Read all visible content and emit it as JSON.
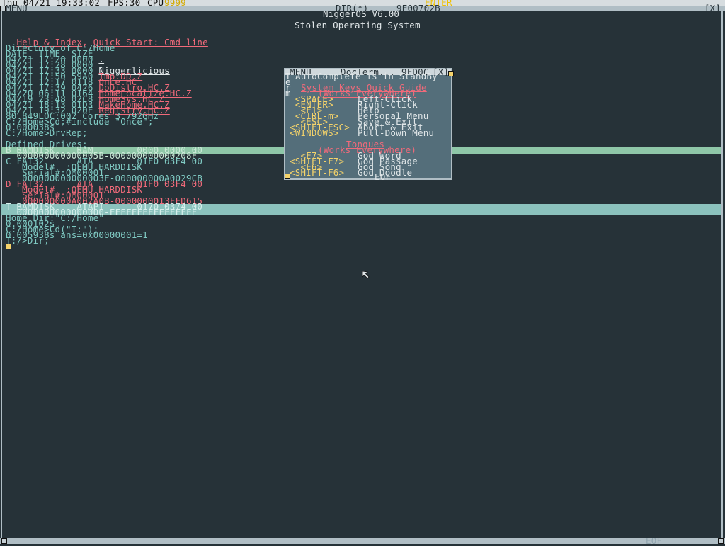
{
  "topbar": {
    "date_time": "Thu 04/21 19:33:02",
    "fps": "FPS:30",
    "cpu_label": "CPU",
    "cpu_value": "9999",
    "enter": "ENTER"
  },
  "window": {
    "menu_label": "MENU",
    "os_title": "NiggerOS V6.00",
    "subtitle": "Stolen Operating System",
    "close": "[X]",
    "title_mid": "DIR(*)...",
    "title_addr": "9E00702B"
  },
  "help_line": {
    "help": "Help & Index",
    "sep": ", ",
    "quick": "Quick Start: Cmd line"
  },
  "dir_header": "Directory of C:/Home",
  "dir_columns": "DATE_ TIME_ SIZE",
  "dir_rows": [
    {
      "meta": "04/21 17:28 0000",
      "name": "."
    },
    {
      "meta": "04/21 17:28 0000",
      "name": ".."
    },
    {
      "meta": "04/21 17:33 0000",
      "name": "Niggerlicious"
    },
    {
      "meta": "04/21 17:50 59A0",
      "name": "Tmp.DD.Z"
    },
    {
      "meta": "04/21 12:17 0118",
      "name": "Once.HC"
    },
    {
      "meta": "04/21 17:39 0426",
      "name": "DoDistro.HC.Z"
    },
    {
      "meta": "04/20 06:11 0164",
      "name": "HomeLocalize.HC.Z"
    },
    {
      "meta": "04/19 23:48 02C8",
      "name": "HomeSys.HC.Z"
    },
    {
      "meta": "04/21 18:13 01D3",
      "name": "MakeHome.HC.Z"
    },
    {
      "meta": "04/21 19:32 020E",
      "name": "Registry.HC.Z"
    }
  ],
  "console_a": [
    "80.849LOC:002 Cores 3.792GHz",
    "C:/Home>Cd;#include \"Once\";",
    "0.000038s",
    "C:/Home>DrvRep;"
  ],
  "drives_header": "Defined Drives:",
  "drives": {
    "b_line1": "B RAMDISK    RAM        0000 0000 00",
    "b_line2": "  000000000000005B-000000000000208F",
    "c_line1": "C FAT32      ATA        01F0 03F4 00",
    "c_line2": "   Model#  :QEMU HARDDISK",
    "c_line3": "   Serial#:QM00001",
    "c_line4": "   000000000000003F-000000000A0029CB",
    "d_line1": "D FAT32      ATA        01F0 03F4 00",
    "d_line2": "   Model#  :QEMU HARDDISK",
    "d_line3": "   Serial#:QM00001",
    "d_line4": "   000000000A002A0B-0000000013FFD615",
    "t_line1": "T RAMDISK    ATAPI      0170 0374 00",
    "t_line2": "  0000000000000000-FFFFFFFFFFFFFFFF"
  },
  "console_b": [
    "Home Dir:\"C:/Home\"",
    "0.000102s",
    "C:/Home>Cd(\"T:\");",
    "0.005938s ans=0x00000001=1",
    "T:/>Dir;"
  ],
  "popup": {
    "menu": "MENU",
    "title": "DocTerm...",
    "addr": "9FD0C",
    "close": "[X]",
    "standby": "AutoComplete is in StandBy",
    "left_chars": [
      "T",
      "e",
      "r",
      "m"
    ],
    "keys_title": "System Keys Quick Guide",
    "works": "(Works Everywhere)",
    "keys": [
      {
        "key": " <SPACE> ",
        "desc": "Left-Click"
      },
      {
        "key": " <ENTER> ",
        "desc": "Right-Click"
      },
      {
        "key": "  <F1>   ",
        "desc": "Help"
      },
      {
        "key": " <CTRL-m>",
        "desc": "Personal Menu"
      },
      {
        "key": "  <ESC>  ",
        "desc": "Save & Exit"
      },
      {
        "key": "<SHIFT-ESC>",
        "desc": "Abort & Exit"
      },
      {
        "key": "<WINDOWS>",
        "desc": "Pull-Down Menu"
      }
    ],
    "tongues_title": "Tongues",
    "tongues_works": "(Works Everywhere)",
    "tongues": [
      {
        "key": "  <F7>   ",
        "desc": "God Word"
      },
      {
        "key": "<SHIFT-F7>",
        "desc": "God Passage"
      },
      {
        "key": "  <F6>   ",
        "desc": "God Song"
      },
      {
        "key": "<SHIFT-F6>",
        "desc": "God Doodle"
      }
    ],
    "eof": "EOF"
  },
  "bottom_eof": "EOF",
  "colors": {
    "background": "#263238",
    "text": "#b0bec5",
    "link": "#f06a7a",
    "highlight_green": "#8fc7a8",
    "highlight_teal": "#8bc2bd",
    "popup_bg": "#546e7a",
    "key_yellow": "#f5d36a"
  }
}
